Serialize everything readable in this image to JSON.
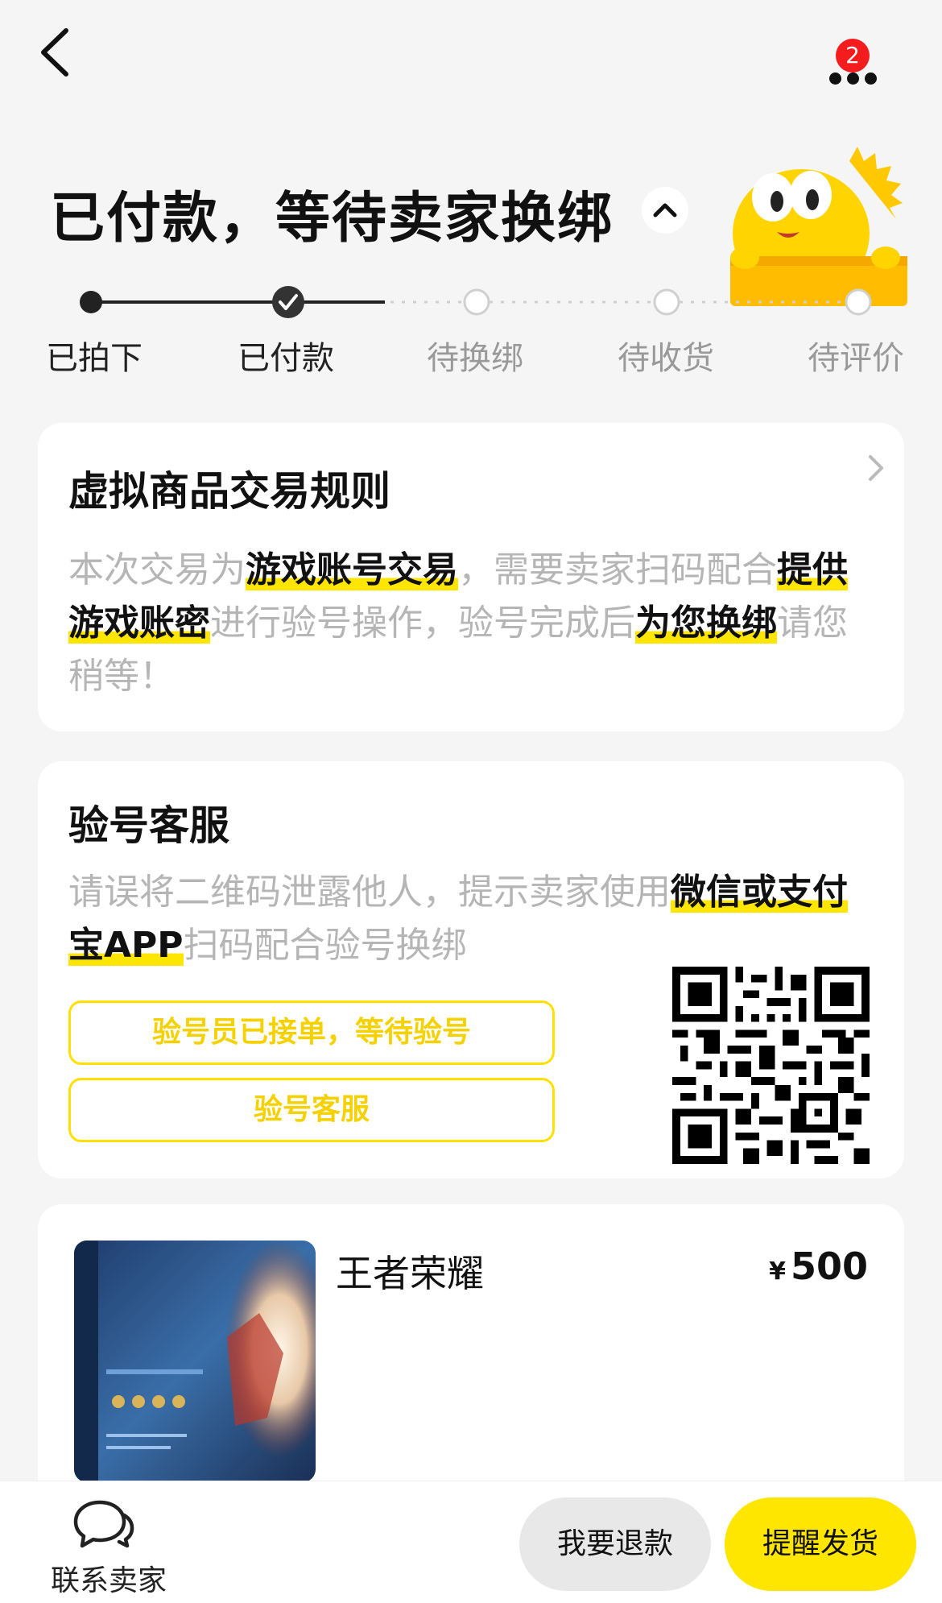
{
  "header": {
    "back_icon": "chevron-left-icon",
    "more_icon": "more-dots-icon",
    "badge_count": "2"
  },
  "status": {
    "title": "已付款，等待卖家换绑",
    "collapse_icon": "chevron-up-icon"
  },
  "progress": {
    "steps": [
      {
        "label": "已拍下",
        "state": "done"
      },
      {
        "label": "已付款",
        "state": "current"
      },
      {
        "label": "待换绑",
        "state": "pending"
      },
      {
        "label": "待收货",
        "state": "pending"
      },
      {
        "label": "待评价",
        "state": "pending"
      }
    ]
  },
  "rules": {
    "title": "虚拟商品交易规则",
    "t1": "本次交易为",
    "h1": "游戏账号交易",
    "t2": "，需要卖家扫码配合",
    "h2": "提供游戏账密",
    "t3": "进行验号操作，验号完成后",
    "h3": "为您换绑",
    "t4": "请您稍等！"
  },
  "verify": {
    "title": "验号客服",
    "t1": "请误将二维码泄露他人，提示卖家使用",
    "h1": "微信或支付宝APP",
    "t2": "扫码配合验号换绑",
    "status_button": "验号员已接单，等待验号",
    "service_button": "验号客服"
  },
  "product": {
    "name": "王者荣耀",
    "currency": "¥",
    "price": "500"
  },
  "bottom": {
    "contact_label": "联系卖家",
    "refund_label": "我要退款",
    "remind_label": "提醒发货"
  },
  "colors": {
    "accent": "#ffe600",
    "badge": "#f41c1c",
    "muted_text": "#b5b5b5"
  }
}
